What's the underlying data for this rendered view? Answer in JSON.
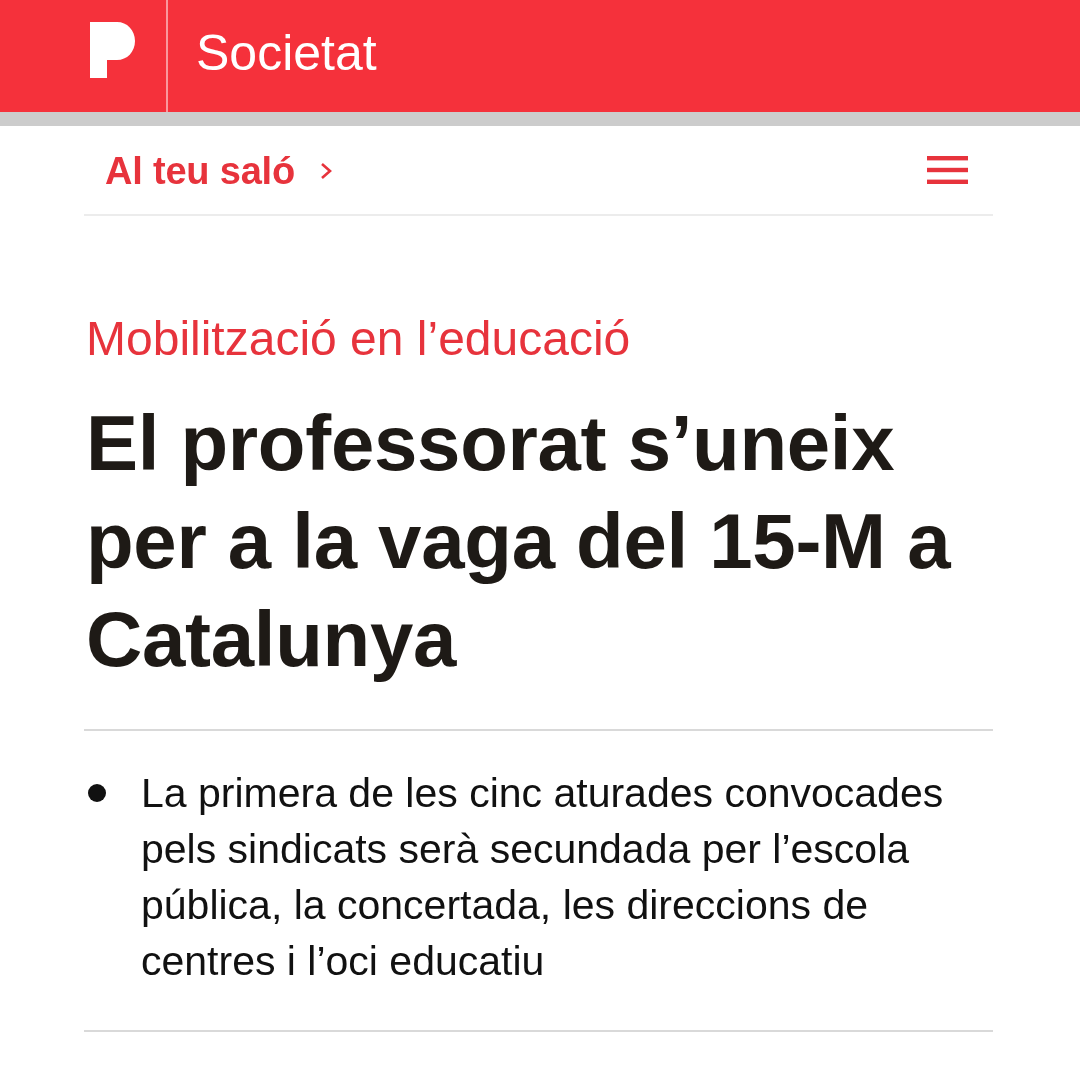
{
  "header": {
    "section": "Societat"
  },
  "nav": {
    "link": "Al teu saló"
  },
  "article": {
    "kicker": "Mobilització en l’educació",
    "headline": "El professorat s’uneix per a la vaga del 15-M a Catalunya",
    "summary": [
      "La primera de les cinc aturades convocades pels sindicats serà secundada per l’escola pública, la concertada, les direccions de centres i l’oci educatiu"
    ]
  }
}
